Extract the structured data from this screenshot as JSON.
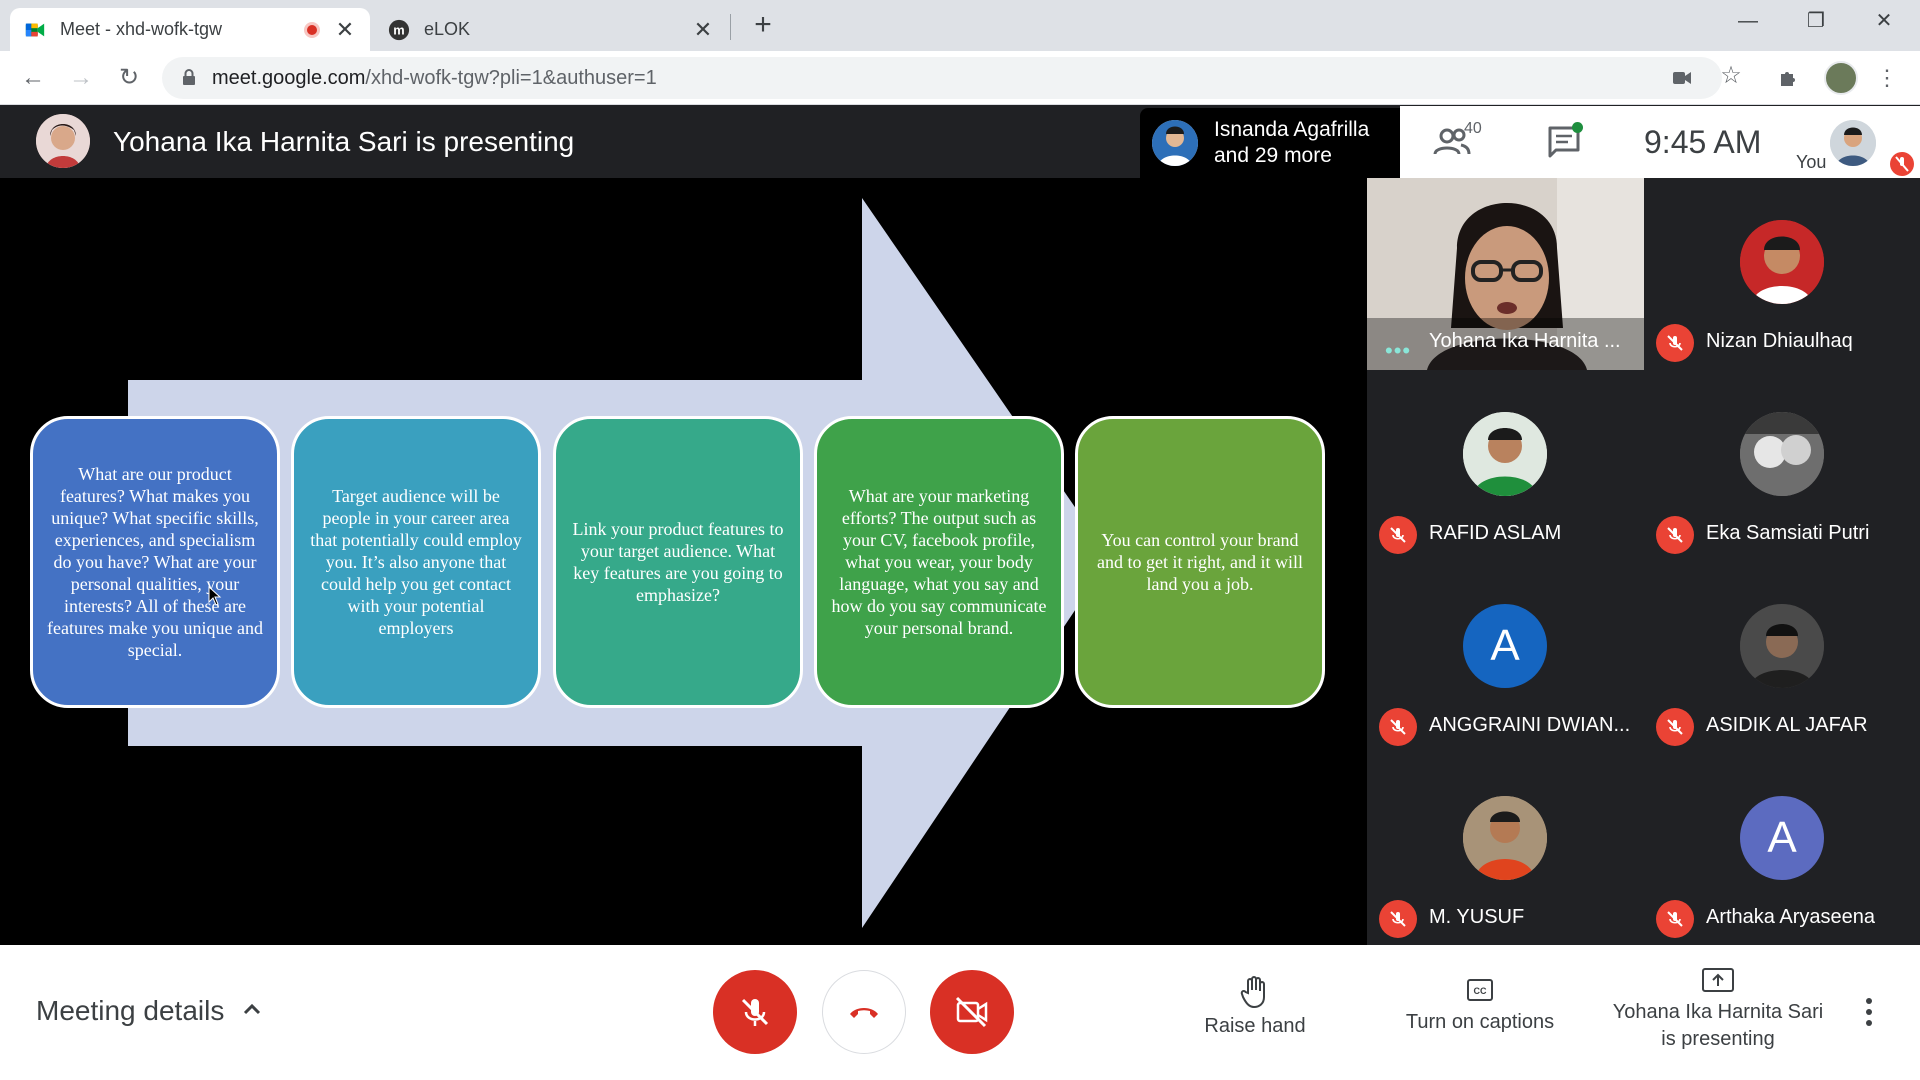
{
  "browser": {
    "tabs": [
      {
        "title": "Meet - xhd-wofk-tgw",
        "active": true,
        "recording": true
      },
      {
        "title": "eLOK",
        "active": false
      }
    ],
    "url_host": "meet.google.com",
    "url_path": "/xhd-wofk-tgw?pli=1&authuser=1"
  },
  "header": {
    "presenting_title": "Yohana Ika Harnita Sari is presenting",
    "speaker_name": "Isnanda Agafrilla",
    "speaker_more": "and 29 more",
    "participant_count": "40",
    "time": "9:45 AM",
    "you_label": "You"
  },
  "slide": {
    "boxes": [
      "What are our product features? What makes you unique? What specific skills, experiences, and specialism do you have? What are your personal qualities, your interests? All of these are features make you unique and special.",
      "Target audience  will be people in your career area that potentially could employ you. It’s also anyone that could help you get contact with your potential employers",
      "Link your product features to your target audience. What key features are you going to emphasize?",
      "What are your marketing efforts? The output such as your CV, facebook profile, what you wear, your body language, what you say and how do you say communicate your personal brand.",
      "You can control your brand and to get it right, and it will land you a job."
    ],
    "colors": {
      "arrow": "#cdd5ea",
      "b1": "#4472c4",
      "b2": "#3aa0bf",
      "b3": "#36a98a",
      "b4": "#3fa24a",
      "b5": "#6aa43c"
    }
  },
  "participants": [
    {
      "name": "Yohana Ika Harnita ...",
      "type": "video"
    },
    {
      "name": "Nizan Dhiaulhaq",
      "type": "photo",
      "muted": true
    },
    {
      "name": "RAFID ASLAM",
      "type": "photo",
      "muted": true
    },
    {
      "name": "Eka Samsiati Putri",
      "type": "photo",
      "muted": true
    },
    {
      "name": "ANGGRAINI DWIAN...",
      "type": "letter",
      "letter": "A",
      "color": "#1565c0",
      "muted": true
    },
    {
      "name": "ASIDIK AL JAFAR",
      "type": "photo",
      "muted": true
    },
    {
      "name": "M. YUSUF",
      "type": "photo",
      "muted": true
    },
    {
      "name": "Arthaka Aryaseena",
      "type": "letter",
      "letter": "A",
      "color": "#5c6bc0",
      "muted": true
    }
  ],
  "bottom": {
    "meeting_details": "Meeting details",
    "raise_hand": "Raise hand",
    "captions": "Turn on captions",
    "presenting_line1": "Yohana Ika Harnita Sari",
    "presenting_line2": "is presenting"
  }
}
